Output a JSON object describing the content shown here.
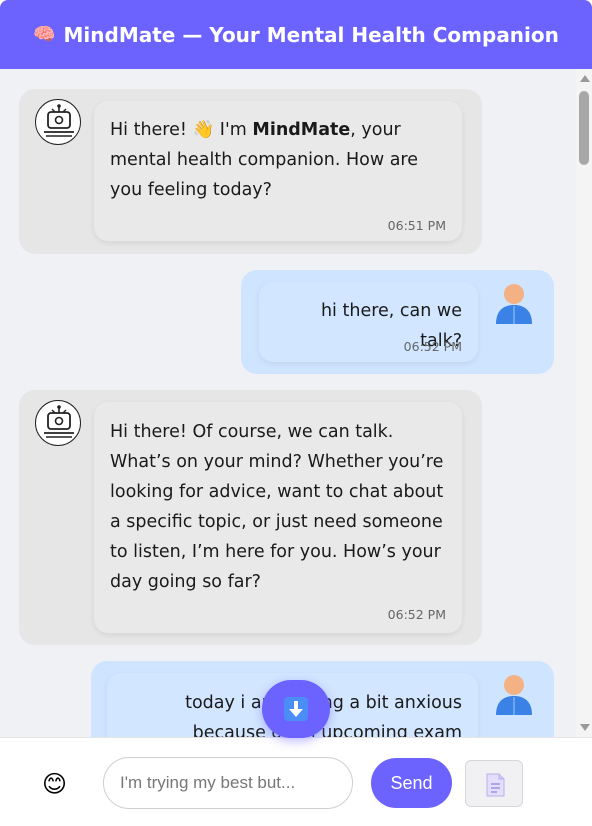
{
  "header": {
    "icon": "brain-icon",
    "title": "MindMate — Your Mental Health Companion"
  },
  "messages": [
    {
      "sender": "bot",
      "text_before": "Hi there! 👋 I'm ",
      "text_bold": "MindMate",
      "text_after": ", your mental health companion. How are you feeling today?",
      "time": "06:51 PM"
    },
    {
      "sender": "user",
      "text": "hi there, can we talk?",
      "time": "06:52 PM"
    },
    {
      "sender": "bot",
      "text": "Hi there! Of course, we can talk. What’s on your mind? Whether you’re looking for advice, want to chat about a specific topic, or just need someone to listen, I’m here for you. How’s your day going so far?",
      "time": "06:52 PM"
    },
    {
      "sender": "user",
      "text_line1": "today i am feeling a bit anxious",
      "text_line2": "because of an upcoming exam"
    }
  ],
  "input": {
    "placeholder": "I'm trying my best but...",
    "value": ""
  },
  "buttons": {
    "send_label": "Send",
    "emoji": "😊",
    "scroll_down_icon": "arrow-down-icon",
    "document_icon": "document-icon"
  },
  "colors": {
    "accent": "#6c63ff",
    "bot_bubble": "#e6e6e6",
    "user_bubble": "#cfe5ff",
    "chat_background": "#f0f1f5"
  }
}
